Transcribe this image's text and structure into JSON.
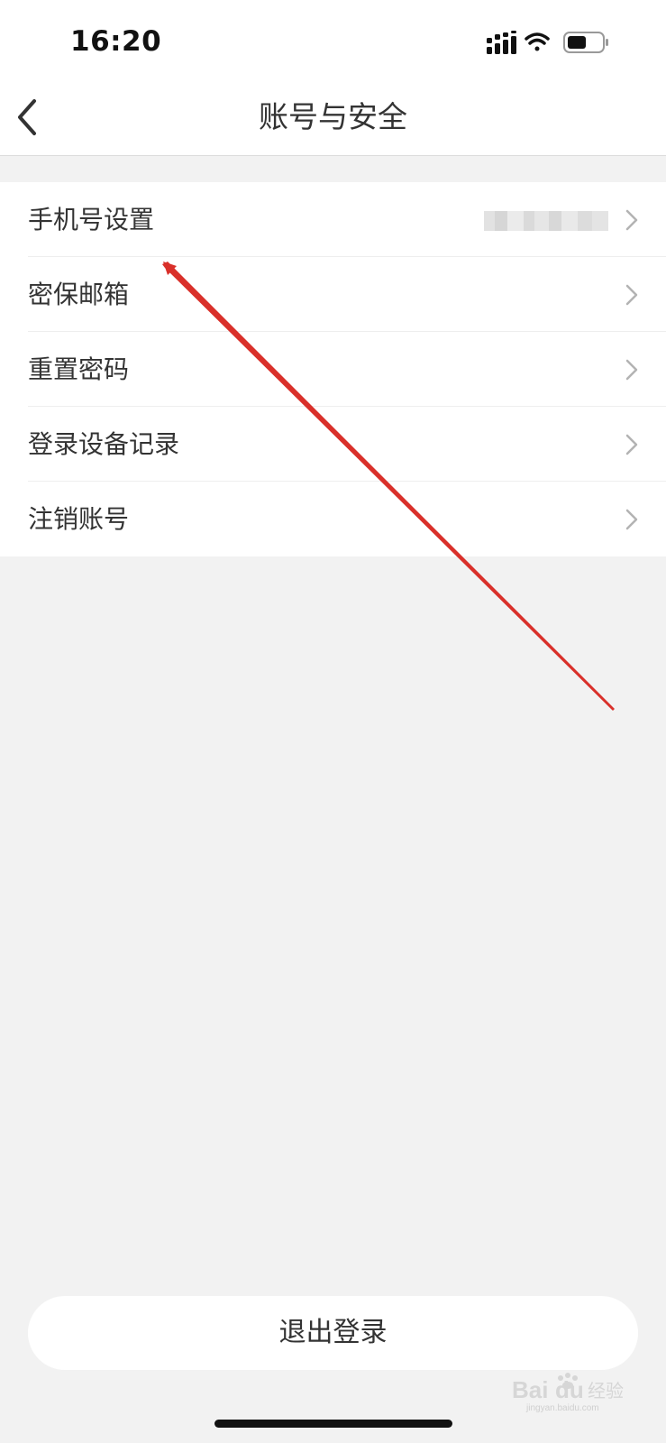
{
  "status_bar": {
    "time": "16:20",
    "icons": [
      "cellular-signal-icon",
      "wifi-icon",
      "battery-icon"
    ],
    "battery_level": 0.55
  },
  "nav": {
    "back_icon": "chevron-left-icon",
    "title": "账号与安全"
  },
  "menu": {
    "items": [
      {
        "label": "手机号设置",
        "value": "",
        "value_masked": true
      },
      {
        "label": "密保邮箱"
      },
      {
        "label": "重置密码"
      },
      {
        "label": "登录设备记录"
      },
      {
        "label": "注销账号"
      }
    ],
    "chevron_icon": "chevron-right-icon"
  },
  "logout": {
    "label": "退出登录"
  },
  "watermark": {
    "logo": "Baidu经验",
    "domain": "jingyan.baidu.com"
  },
  "colors": {
    "background": "#f2f2f2",
    "surface": "#ffffff",
    "text": "#333333",
    "chevron": "#b3b3b3",
    "annotation_arrow": "#d9302a"
  }
}
